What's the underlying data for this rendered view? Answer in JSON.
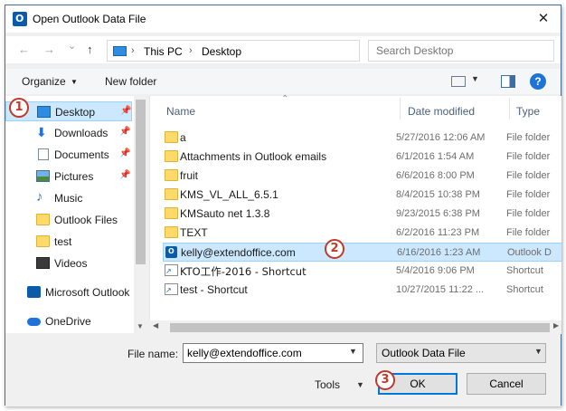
{
  "window": {
    "title": "Open Outlook Data File",
    "close_glyph": "✕"
  },
  "address_bar": {
    "back_glyph": "←",
    "forward_glyph": "→",
    "recent_glyph": "⌄",
    "up_glyph": "↑",
    "breadcrumb": [
      "This PC",
      "Desktop"
    ],
    "breadcrumb_sep": "›",
    "search_placeholder": "Search Desktop"
  },
  "toolbar": {
    "organize_label": "Organize",
    "organize_arrow": "▼",
    "new_folder_label": "New folder",
    "view_arrow": "▼",
    "help_glyph": "?"
  },
  "nav_pane": {
    "items": [
      {
        "label": "Desktop",
        "icon": "desktop-icon",
        "pinned": true,
        "selected": true
      },
      {
        "label": "Downloads",
        "icon": "downloads-icon",
        "pinned": true
      },
      {
        "label": "Documents",
        "icon": "documents-icon",
        "pinned": true
      },
      {
        "label": "Pictures",
        "icon": "pictures-icon",
        "pinned": true
      },
      {
        "label": "Music",
        "icon": "music-icon"
      },
      {
        "label": "Outlook Files",
        "icon": "folder-icon"
      },
      {
        "label": "test",
        "icon": "folder-icon"
      },
      {
        "label": "Videos",
        "icon": "videos-icon"
      },
      {
        "label": "Microsoft Outlook",
        "icon": "outlook-icon"
      },
      {
        "label": "OneDrive",
        "icon": "onedrive-icon"
      }
    ],
    "pin_glyph": "📌",
    "scroll_down_glyph": "▼"
  },
  "file_list": {
    "columns": {
      "name": "Name",
      "date": "Date modified",
      "type": "Type"
    },
    "sort_glyph": "⌃",
    "rows": [
      {
        "name": "a",
        "date": "5/27/2016 12:06 AM",
        "type": "File folder",
        "icon": "folder-icon"
      },
      {
        "name": "Attachments in Outlook emails",
        "date": "6/1/2016 1:54 AM",
        "type": "File folder",
        "icon": "folder-icon"
      },
      {
        "name": "fruit",
        "date": "6/6/2016 8:00 PM",
        "type": "File folder",
        "icon": "folder-icon"
      },
      {
        "name": "KMS_VL_ALL_6.5.1",
        "date": "8/4/2015 10:38 PM",
        "type": "File folder",
        "icon": "folder-icon"
      },
      {
        "name": "KMSauto net 1.3.8",
        "date": "9/23/2015 6:38 PM",
        "type": "File folder",
        "icon": "folder-icon"
      },
      {
        "name": "TEXT",
        "date": "6/2/2016 11:23 PM",
        "type": "File folder",
        "icon": "folder-icon"
      },
      {
        "name": "kelly@extendoffice.com",
        "date": "6/16/2016 1:23 AM",
        "type": "Outlook D",
        "icon": "pst-file-icon",
        "selected": true
      },
      {
        "name": "KTO工作-2016 - Shortcut",
        "date": "5/4/2016 9:06 PM",
        "type": "Shortcut",
        "icon": "shortcut-icon"
      },
      {
        "name": "test - Shortcut",
        "date": "10/27/2015 11:22 ...",
        "type": "Shortcut",
        "icon": "shortcut-icon"
      }
    ],
    "scroll_left_glyph": "◀",
    "scroll_right_glyph": "▶"
  },
  "bottom": {
    "file_name_label": "File name:",
    "file_name_value": "kelly@extendoffice.com",
    "dropdown_glyph": "▼",
    "file_type_value": "Outlook Data File",
    "tools_label": "Tools",
    "ok_label": "OK",
    "cancel_label": "Cancel"
  },
  "annotations": {
    "badge_1": "1",
    "badge_2": "2",
    "badge_3": "3"
  },
  "colors": {
    "selection": "#cce8ff",
    "selection_border": "#99d1ff",
    "badge": "#c0392b",
    "ok_border": "#0078d7"
  }
}
